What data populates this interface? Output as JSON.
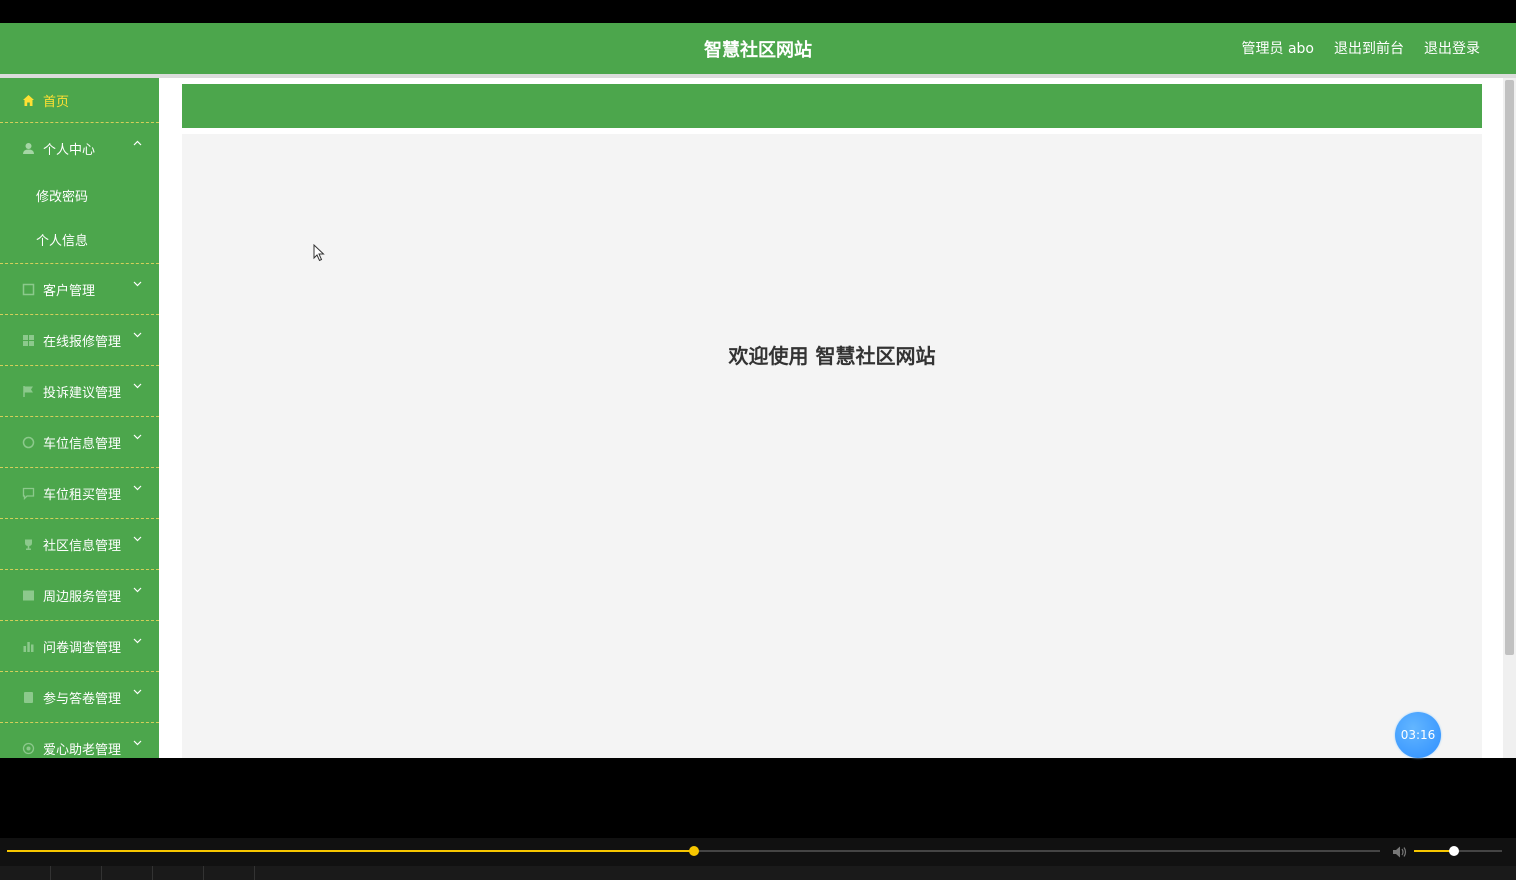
{
  "header": {
    "title": "智慧社区网站",
    "admin_label": "管理员 abo",
    "back_to_front": "退出到前台",
    "logout": "退出登录"
  },
  "sidebar": {
    "home": "首页",
    "personal_center": {
      "label": "个人中心",
      "children": [
        "修改密码",
        "个人信息"
      ]
    },
    "items": [
      {
        "label": "客户管理",
        "icon": "customer-icon"
      },
      {
        "label": "在线报修管理",
        "icon": "grid-icon"
      },
      {
        "label": "投诉建议管理",
        "icon": "flag-icon"
      },
      {
        "label": "车位信息管理",
        "icon": "circle-icon"
      },
      {
        "label": "车位租买管理",
        "icon": "message-icon"
      },
      {
        "label": "社区信息管理",
        "icon": "trophy-icon"
      },
      {
        "label": "周边服务管理",
        "icon": "picture-icon"
      },
      {
        "label": "问卷调查管理",
        "icon": "bar-chart-icon"
      },
      {
        "label": "参与答卷管理",
        "icon": "document-icon"
      },
      {
        "label": "爱心助老管理",
        "icon": "heart-icon"
      }
    ]
  },
  "main": {
    "welcome": "欢迎使用 智慧社区网站"
  },
  "timer": "03:16",
  "player": {
    "progress": 0.5,
    "volume": 0.45
  },
  "colors": {
    "brand_green": "#4ca64c",
    "home_active": "#ffe033",
    "progress": "#f7c600",
    "timer_blue": "#2e8fff"
  }
}
